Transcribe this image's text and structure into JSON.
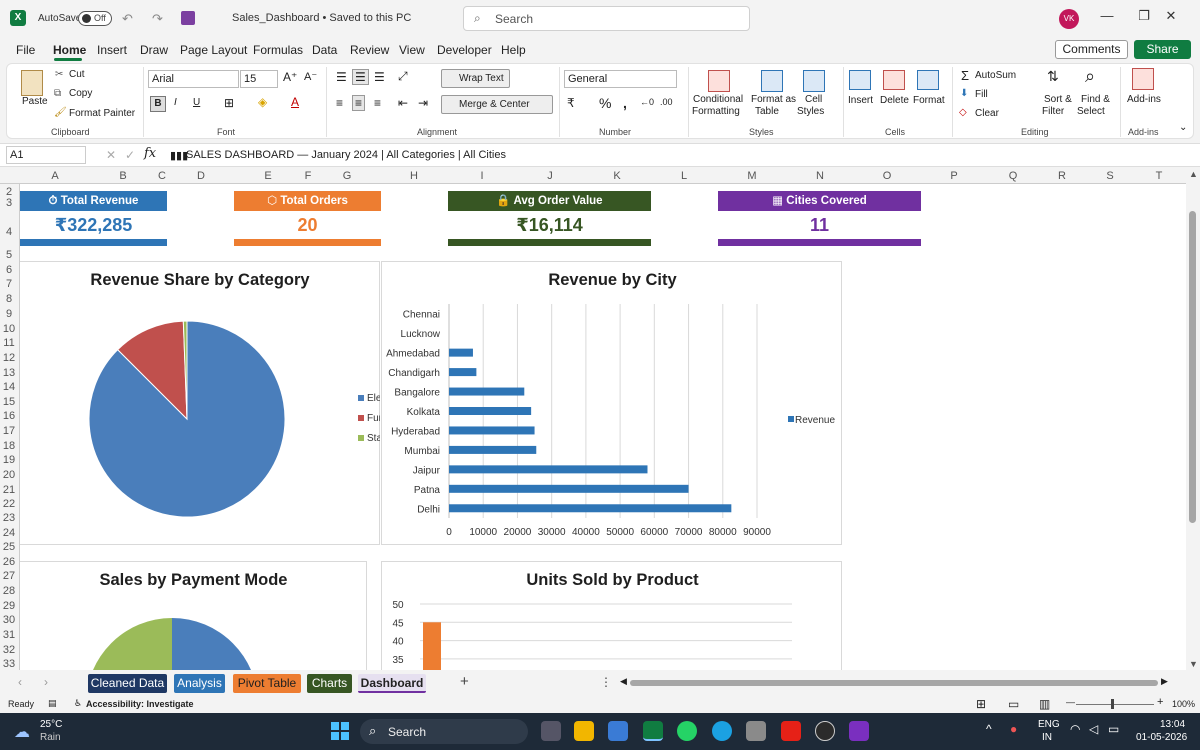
{
  "titlebar": {
    "autosave_label": "AutoSave",
    "autosave_state": "Off",
    "file_title": "Sales_Dashboard • Saved to this PC",
    "search_placeholder": "Search",
    "avatar": "VK"
  },
  "menu": {
    "items": [
      "File",
      "Home",
      "Insert",
      "Draw",
      "Page Layout",
      "Formulas",
      "Data",
      "Review",
      "View",
      "Developer",
      "Help"
    ],
    "comments": "Comments",
    "share": "Share"
  },
  "ribbon": {
    "clipboard": {
      "paste": "Paste",
      "cut": "Cut",
      "copy": "Copy",
      "format_painter": "Format Painter",
      "label": "Clipboard"
    },
    "font": {
      "name": "Arial",
      "size": "15",
      "label": "Font",
      "bold": "B",
      "italic": "I",
      "underline": "U"
    },
    "alignment": {
      "wrap": "Wrap Text",
      "merge": "Merge & Center",
      "label": "Alignment"
    },
    "number": {
      "format": "General",
      "label": "Number"
    },
    "styles": {
      "conditional": "Conditional",
      "formatting": "Formatting",
      "format_as": "Format as",
      "table": "Table",
      "cell": "Cell",
      "cell_styles": "Styles",
      "label": "Styles"
    },
    "cells": {
      "insert": "Insert",
      "delete": "Delete",
      "format": "Format",
      "label": "Cells"
    },
    "editing": {
      "autosum": "AutoSum",
      "fill": "Fill",
      "clear": "Clear",
      "sort": "Sort &",
      "filter": "Filter",
      "find": "Find &",
      "select": "Select",
      "label": "Editing"
    },
    "addins": {
      "label": "Add-ins",
      "text": "Add-ins"
    }
  },
  "formula": {
    "namebox": "A1",
    "content": "SALES DASHBOARD — January 2024  |  All Categories  |  All Cities"
  },
  "columns": [
    "A",
    "B",
    "C",
    "D",
    "E",
    "F",
    "G",
    "H",
    "I",
    "J",
    "K",
    "L",
    "M",
    "N",
    "O",
    "P",
    "Q",
    "R",
    "S",
    "T"
  ],
  "rows": [
    "2",
    "3",
    "4",
    "5",
    "6",
    "7",
    "8",
    "9",
    "10",
    "11",
    "12",
    "13",
    "14",
    "15",
    "16",
    "17",
    "18",
    "19",
    "20",
    "21",
    "22",
    "23",
    "24",
    "25",
    "26",
    "27",
    "28",
    "29",
    "30",
    "31",
    "32",
    "33"
  ],
  "kpis": [
    {
      "title": "Total Revenue",
      "value": "₹322,285",
      "color": "#2e75b6"
    },
    {
      "title": "Total Orders",
      "value": "20",
      "color": "#ed7d31"
    },
    {
      "title": "Avg Order Value",
      "value": "₹16,114",
      "color": "#375623"
    },
    {
      "title": "Cities Covered",
      "value": "11",
      "color": "#7030a0"
    }
  ],
  "chart_data": [
    {
      "type": "pie",
      "title": "Revenue Share by Category",
      "labels": [
        "Ele",
        "Fur",
        "Sta"
      ],
      "values": [
        87.5,
        11.9,
        0.6
      ],
      "colors": [
        "#4a7ebb",
        "#c0504d",
        "#9bbb59"
      ]
    },
    {
      "type": "bar",
      "orientation": "horizontal",
      "title": "Revenue by City",
      "categories": [
        "Chennai",
        "Lucknow",
        "Ahmedabad",
        "Chandigarh",
        "Bangalore",
        "Kolkata",
        "Hyderabad",
        "Mumbai",
        "Jaipur",
        "Patna",
        "Delhi"
      ],
      "series": [
        {
          "name": "Revenue",
          "values": [
            0,
            0,
            7000,
            8000,
            22000,
            24000,
            25000,
            25500,
            58000,
            70000,
            82500
          ]
        }
      ],
      "xlim": [
        0,
        90000
      ],
      "xticks": [
        0,
        10000,
        20000,
        30000,
        40000,
        50000,
        60000,
        70000,
        80000,
        90000
      ],
      "color": "#2e75b6",
      "grid": true
    },
    {
      "type": "pie",
      "title": "Sales by Payment Mode",
      "colors": [
        "#4a7ebb",
        "#9bbb59"
      ]
    },
    {
      "type": "bar",
      "title": "Units Sold by Product",
      "yticks": [
        50,
        45,
        40,
        35
      ],
      "ylim": [
        30,
        50
      ],
      "values": [
        45
      ],
      "color": "#ed7d31"
    }
  ],
  "sheets": [
    {
      "name": "Cleaned Data",
      "color": "#1f3864"
    },
    {
      "name": "Analysis",
      "color": "#2e75b6"
    },
    {
      "name": "Pivot Table",
      "color": "#ed7d31"
    },
    {
      "name": "Charts",
      "color": "#375623"
    },
    {
      "name": "Dashboard",
      "color": "#e6e0f0"
    }
  ],
  "status": {
    "ready": "Ready",
    "accessibility": "Accessibility: Investigate",
    "zoom": "100%"
  },
  "taskbar": {
    "weather_temp": "25°C",
    "weather_desc": "Rain",
    "search": "Search",
    "lang1": "ENG",
    "lang2": "IN",
    "time": "13:04",
    "date": "01-05-2026"
  }
}
